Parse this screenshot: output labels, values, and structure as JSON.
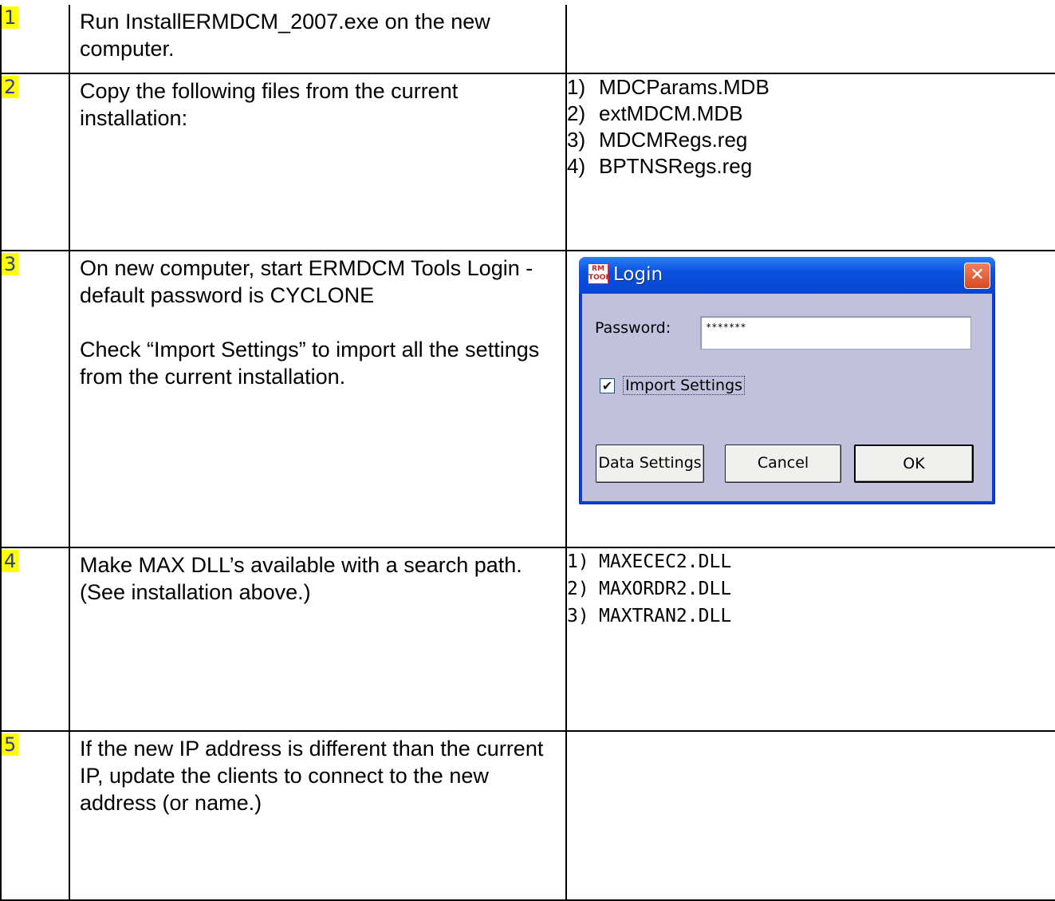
{
  "steps": [
    {
      "number": "1",
      "instruction": [
        "Run InstallERMDCM_2007.exe on the new computer."
      ]
    },
    {
      "number": "2",
      "instruction": [
        "Copy the following files from the current installation:"
      ],
      "files": [
        "MDCParams.MDB",
        "extMDCM.MDB",
        "MDCMRegs.reg",
        "BPTNSRegs.reg"
      ]
    },
    {
      "number": "3",
      "instruction": [
        "On new computer, start ERMDCM Tools Login -  default password is CYCLONE",
        "Check “Import Settings” to import all the settings from the current installation."
      ]
    },
    {
      "number": "4",
      "instruction": [
        "Make MAX DLL’s available with a search path. (See installation above.)"
      ],
      "files": [
        "MAXECEC2.DLL",
        "MAXORDR2.DLL",
        "MAXTRAN2.DLL"
      ]
    },
    {
      "number": "5",
      "instruction": [
        "If the new IP address is different than the current IP, update the clients to connect to the new address (or name.)"
      ]
    }
  ],
  "list_markers": [
    "1)",
    "2)",
    "3)",
    "4)"
  ],
  "login_dialog": {
    "icon_text": "RM TOOL",
    "title": "Login",
    "close_glyph": "✕",
    "password_label": "Password:",
    "password_value": "*******",
    "import_checked": true,
    "check_glyph": "✔",
    "import_label": "Import Settings",
    "buttons": {
      "data_settings": "Data Settings",
      "cancel": "Cancel",
      "ok": "OK"
    },
    "colors": {
      "title_bar": "#0a52e0",
      "client": "#c1c1de",
      "close": "#d84a20"
    }
  },
  "colors": {
    "badge_bg": "#ffff00",
    "badge_text": "#2f3e8f"
  }
}
